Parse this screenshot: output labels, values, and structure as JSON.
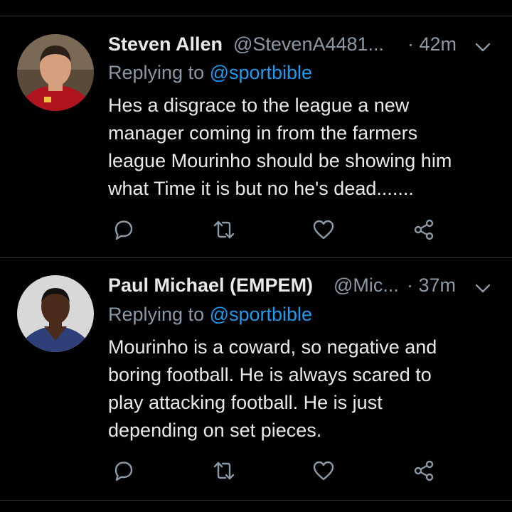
{
  "tweets": [
    {
      "name": "Steven Allen",
      "handle": "@StevenA4481...",
      "time": "· 42m",
      "replying_prefix": "Replying to ",
      "replying_to": "@sportbible",
      "text_lines": [
        "Hes a disgrace to the league a new",
        "manager coming in from the farmers",
        "league Mourinho should be showing him",
        "what Time it is but no he's dead......."
      ],
      "actions": [
        "reply-icon",
        "retweet-icon",
        "like-icon",
        "share-icon"
      ],
      "avatar_colors": {
        "background": "#5a4a3a",
        "shirt": "#b0141e",
        "skin": "#d6a07e",
        "hair": "#2a2018"
      }
    },
    {
      "name": "Paul Michael (EMPEM)",
      "handle": "@Mic...",
      "time": "· 37m",
      "replying_prefix": "Replying to ",
      "replying_to": "@sportbible",
      "text_lines": [
        "Mourinho is a coward, so negative and",
        "boring football. He is always scared to",
        "play attacking football. He is just",
        "depending on set pieces."
      ],
      "actions": [
        "reply-icon",
        "retweet-icon",
        "like-icon",
        "share-icon"
      ],
      "avatar_colors": {
        "background": "#d8d8d8",
        "shirt": "#2e3f7a",
        "skin": "#4a2a1a",
        "hair": "#141010"
      }
    }
  ],
  "colors": {
    "background": "#000000",
    "primary_text": "#e7e9ea",
    "secondary_text": "#8b98a5",
    "link": "#1d9bf0",
    "divider": "#2f3336"
  }
}
